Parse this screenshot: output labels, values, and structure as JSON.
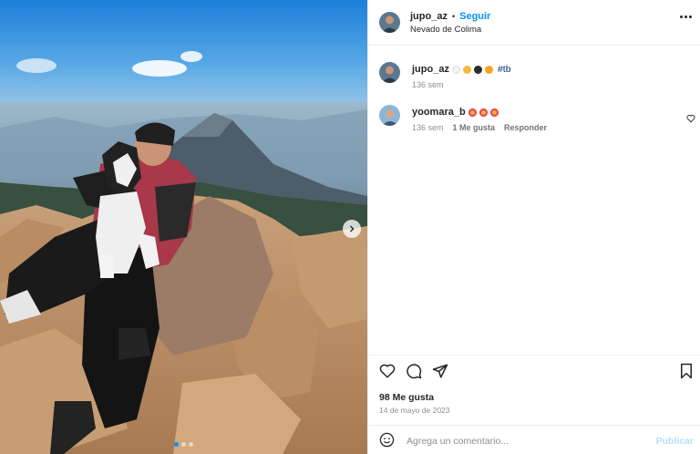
{
  "post": {
    "username": "jupo_az",
    "separator": "•",
    "follow_label": "Seguir",
    "location": "Nevado de Colima",
    "photo_slide": {
      "current": 1,
      "total": 3
    }
  },
  "comments": [
    {
      "username": "jupo_az",
      "emojis": [
        "white-heart",
        "smiling-heart-eyes",
        "black-heart",
        "raising-hands"
      ],
      "hashtag": "#tb",
      "age": "136 sem"
    },
    {
      "username": "yoomara_b",
      "emojis": [
        "heart-eyes",
        "heart-eyes",
        "heart-eyes"
      ],
      "age": "136 sem",
      "likes_label": "1 Me gusta",
      "reply_label": "Responder"
    }
  ],
  "stats": {
    "likes": "98 Me gusta",
    "date": "14 de mayo de 2023"
  },
  "composer": {
    "placeholder": "Agrega un comentario...",
    "publish_label": "Publicar"
  },
  "colors": {
    "accent": "#0095f6",
    "hashtag": "#00376b",
    "muted": "#8e8e8e"
  }
}
